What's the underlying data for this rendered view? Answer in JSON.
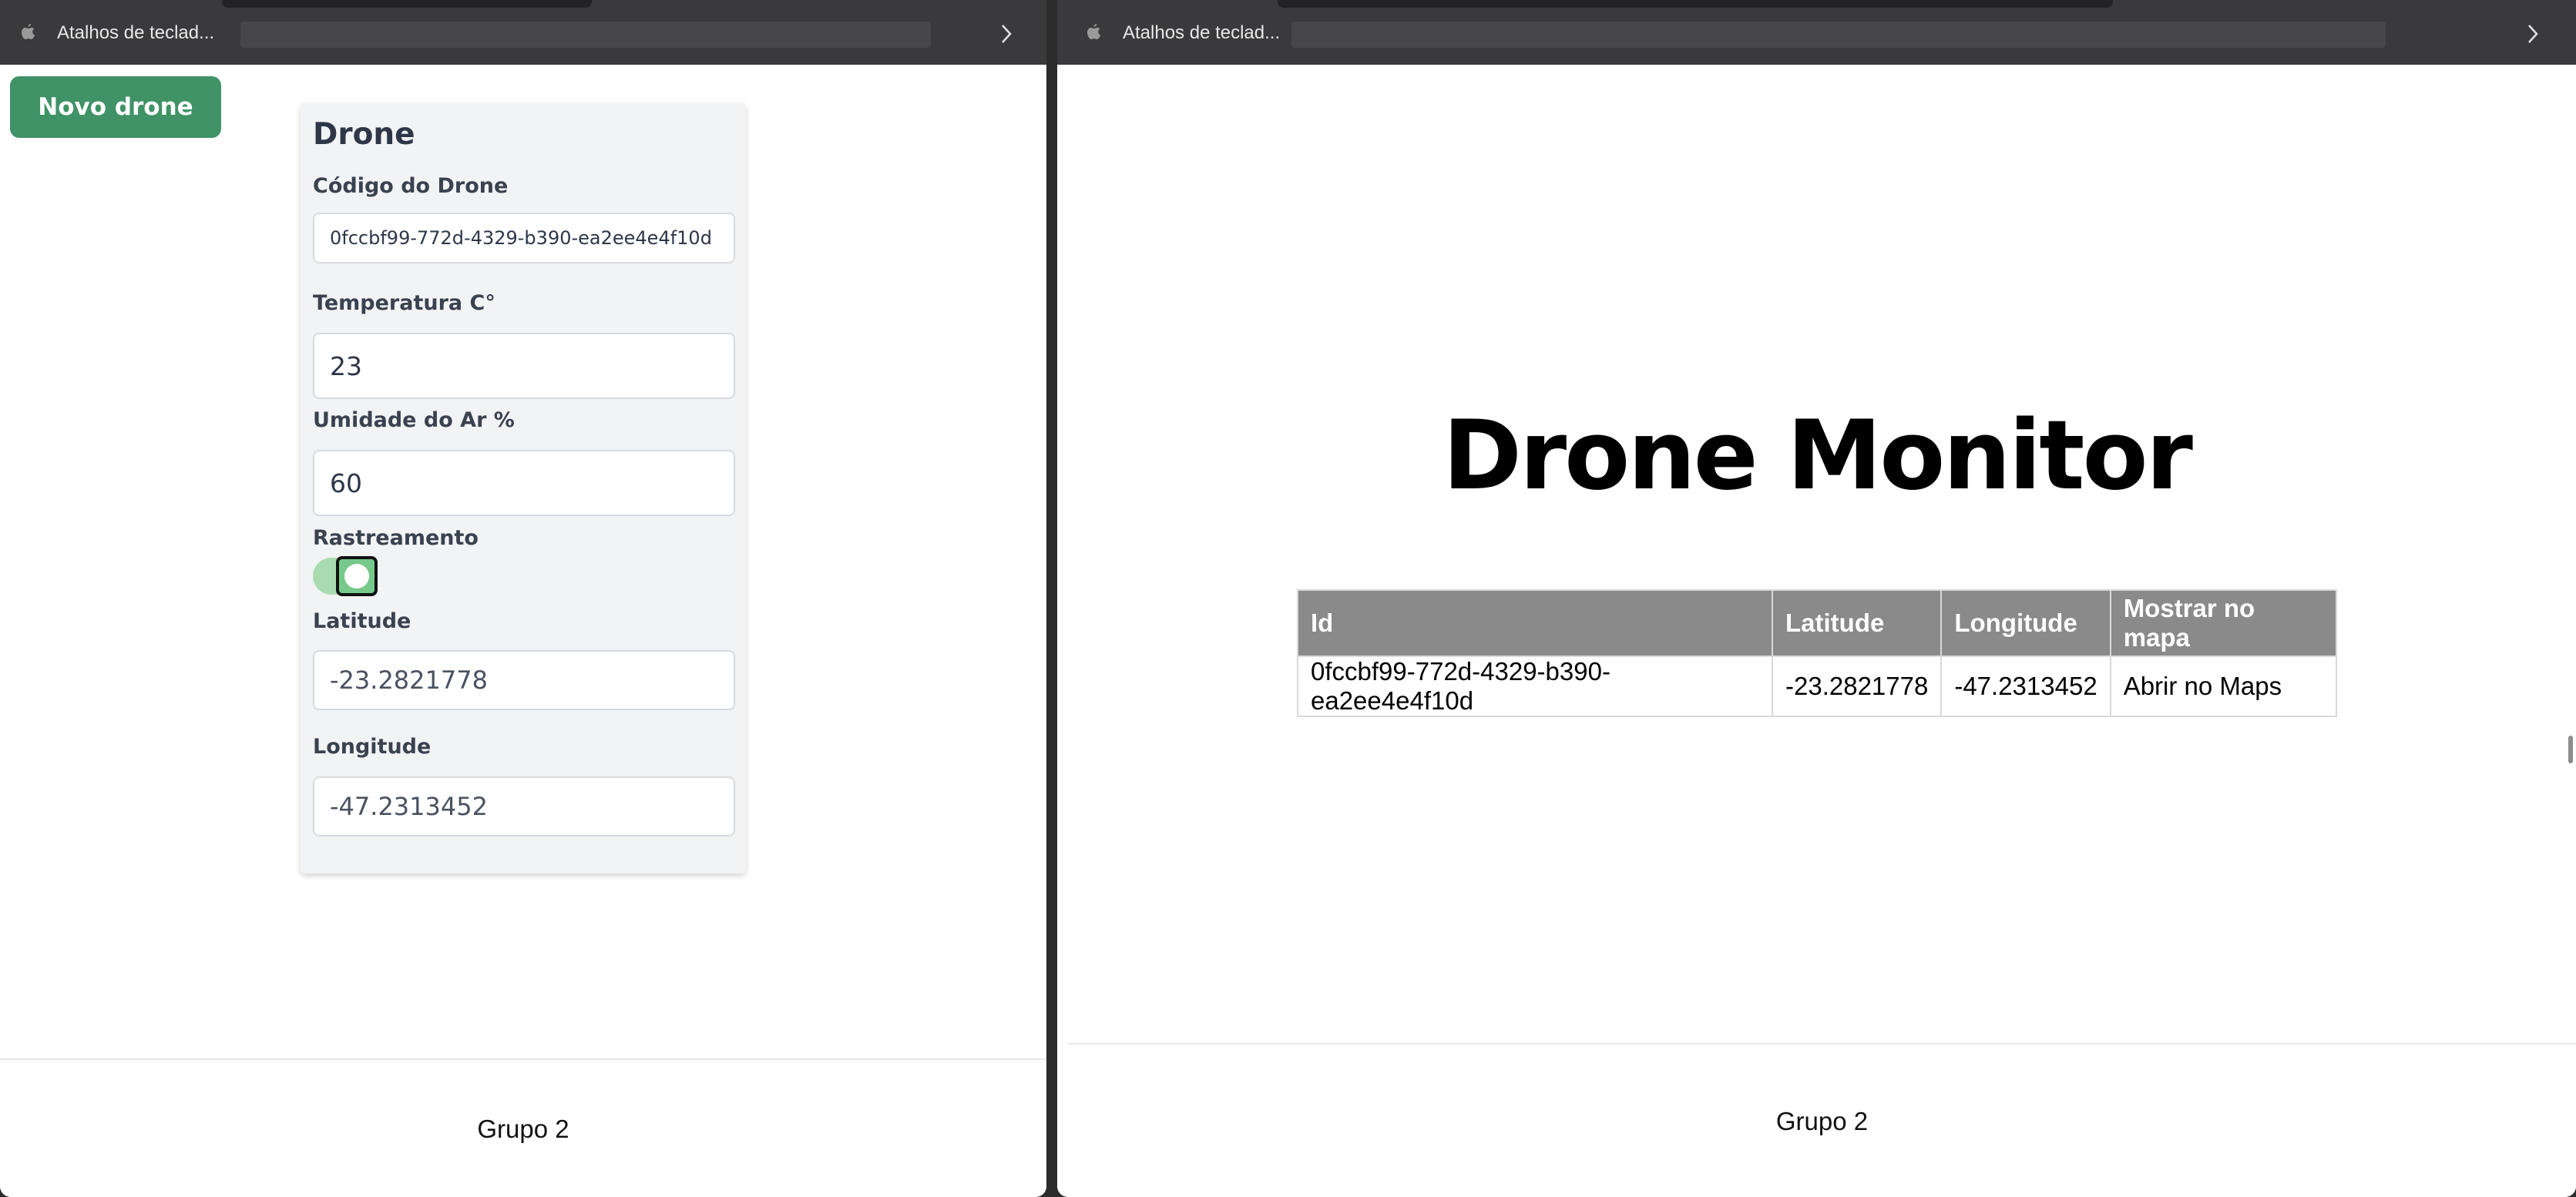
{
  "bookmarks_bar": {
    "bookmark_label": "Atalhos de teclad...",
    "bookmark_icon": "apple-icon",
    "overflow_icon": "chevron-right-icon"
  },
  "left_app": {
    "new_drone_button": "Novo drone",
    "form": {
      "title": "Drone",
      "code_label": "Código do Drone",
      "code_value": "0fccbf99-772d-4329-b390-ea2ee4e4f10d",
      "temperature_label": "Temperatura C°",
      "temperature_value": "23",
      "humidity_label": "Umidade do Ar %",
      "humidity_value": "60",
      "tracking_label": "Rastreamento",
      "tracking_on": true,
      "latitude_label": "Latitude",
      "latitude_value": "-23.2821778",
      "longitude_label": "Longitude",
      "longitude_value": "-47.2313452"
    },
    "footer": "Grupo 2"
  },
  "right_app": {
    "title": "Drone Monitor",
    "table": {
      "headers": [
        "Id",
        "Latitude",
        "Longitude",
        "Mostrar no mapa"
      ],
      "rows": [
        [
          "0fccbf99-772d-4329-b390-ea2ee4e4f10d",
          "-23.2821778",
          "-47.2313452",
          "Abrir no Maps"
        ]
      ]
    },
    "footer": "Grupo 2"
  },
  "colors": {
    "primary_button": "#3f9366",
    "table_header": "#8a8a8a",
    "toggle_on": "#76c98a"
  }
}
